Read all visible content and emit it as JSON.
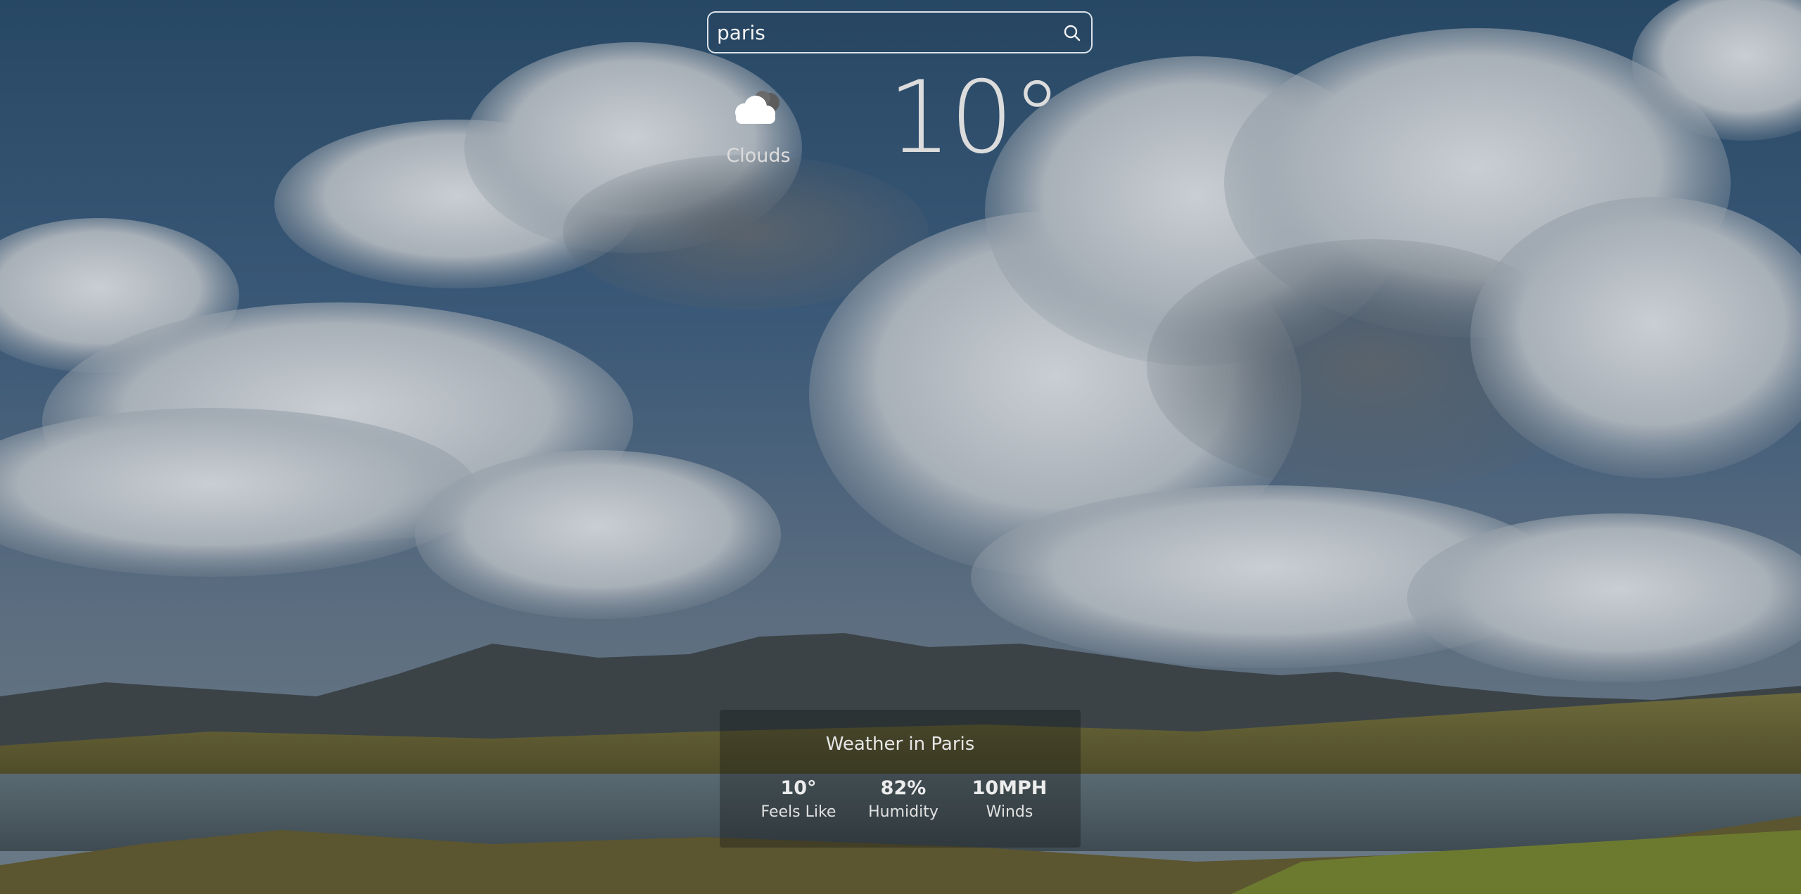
{
  "search": {
    "value": "paris",
    "icon": "search-icon"
  },
  "current": {
    "temperature": "10°",
    "condition": "Clouds",
    "condition_icon": "cloud-icon"
  },
  "details": {
    "title": "Weather in Paris",
    "stats": [
      {
        "value": "10°",
        "label": "Feels Like"
      },
      {
        "value": "82%",
        "label": "Humidity"
      },
      {
        "value": "10MPH",
        "label": "Winds"
      }
    ]
  },
  "colors": {
    "sky": "#2f4d6d",
    "text": "#e8e8e8"
  }
}
